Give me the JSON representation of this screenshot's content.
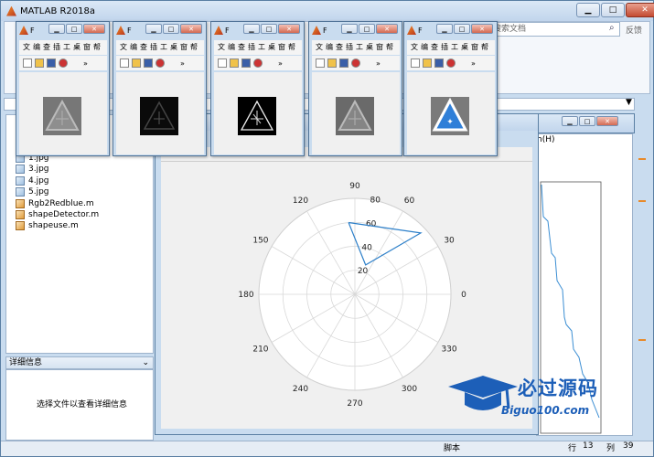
{
  "app": {
    "title": "MATLAB R2018a",
    "search_placeholder": "搜索文档",
    "feedback": "反馈"
  },
  "files": [
    {
      "name": "1.jpg",
      "kind": "image"
    },
    {
      "name": "3.jpg",
      "kind": "image"
    },
    {
      "name": "4.jpg",
      "kind": "image"
    },
    {
      "name": "5.jpg",
      "kind": "image"
    },
    {
      "name": "Rgb2Redblue.m",
      "kind": "m"
    },
    {
      "name": "shapeDetector.m",
      "kind": "m"
    },
    {
      "name": "shapeuse.m",
      "kind": "m"
    }
  ],
  "details": {
    "header": "详细信息",
    "message": "选择文件以查看详细信息"
  },
  "status": {
    "script_label": "脚本",
    "row_label": "行",
    "row_value": "13",
    "col_label": "列",
    "col_value": "39"
  },
  "right_window": {
    "menu_fragment": "h(H)"
  },
  "small_windows": [
    {
      "title": "F",
      "menu": "文编查插工桌窗帮",
      "image": "gray-sign"
    },
    {
      "title": "F",
      "menu": "文编查插工桌窗帮",
      "image": "dark-sign"
    },
    {
      "title": "F",
      "menu": "文编查插工桌窗帮",
      "image": "edge-sign"
    },
    {
      "title": "F",
      "menu": "文编查插工桌窗帮",
      "image": "gray-sign-2"
    },
    {
      "title": "F",
      "menu": "文编查插工桌窗帮",
      "image": "blue-sign"
    }
  ],
  "chart_data": {
    "type": "polar-line",
    "angle_ticks": [
      "0",
      "30",
      "60",
      "90",
      "120",
      "150",
      "180",
      "210",
      "240",
      "270",
      "300",
      "330"
    ],
    "radial_ticks": [
      "20",
      "40",
      "60",
      "80"
    ],
    "rlim": [
      0,
      80
    ],
    "series": [
      {
        "points": [
          {
            "theta": 95,
            "r": 60
          },
          {
            "theta": 43,
            "r": 75
          },
          {
            "theta": 70,
            "r": 26
          },
          {
            "theta": 95,
            "r": 60
          }
        ]
      }
    ],
    "grid": true
  },
  "watermark": {
    "text": "必过源码",
    "url": "Biguo100.com"
  }
}
